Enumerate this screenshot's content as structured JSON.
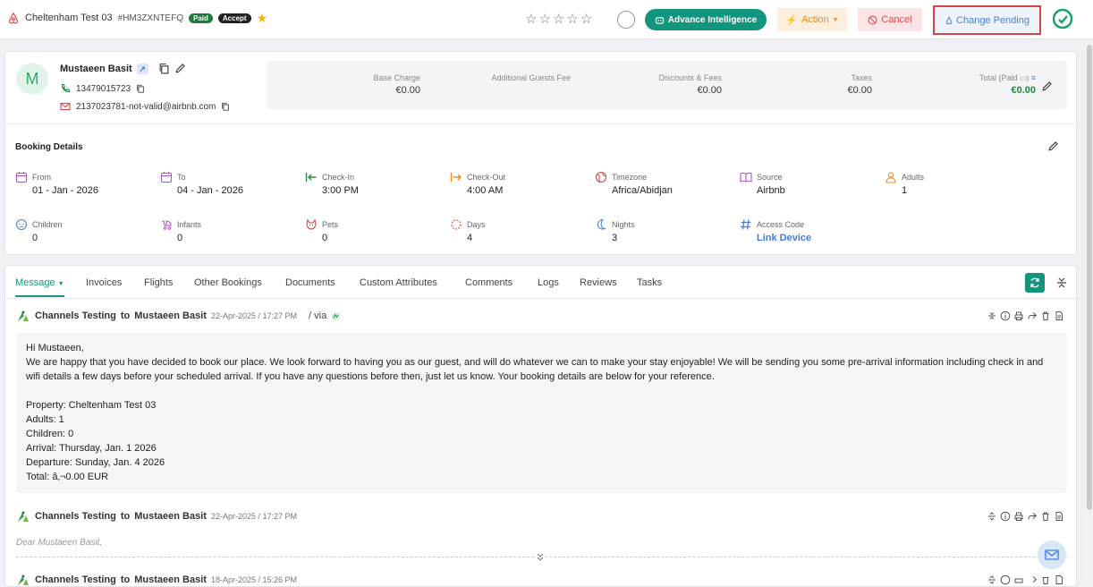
{
  "topbar": {
    "property_title": "Cheltenham Test 03",
    "booking_code": "#HM3ZXNTEFQ",
    "badge_paid": "Paid",
    "badge_accept": "Accept",
    "rating_stars_total": 5,
    "rating_value": 0,
    "ai_button_label": "Advance Intelligence",
    "action_button_label": "Action",
    "cancel_button_label": "Cancel",
    "pending_button_label": "Change Pending",
    "colors": {
      "ai_green": "#11957d",
      "action_orange": "#f08b2a",
      "cancel_red": "#e04b4b",
      "pending_blue": "#4a7fd4",
      "highlight_red": "#d64545"
    }
  },
  "guest": {
    "initial": "M",
    "name": "Mustaeen Basit",
    "phone": "13479015723",
    "email": "2137023781-not-valid@airbnb.com"
  },
  "summary": {
    "base_charge_label": "Base Charge",
    "base_charge_value": "€0.00",
    "guests_fee_label": "Additional Guests Fee",
    "discounts_label": "Discounts & Fees",
    "discounts_value": "€0.00",
    "taxes_label": "Taxes",
    "taxes_value": "€0.00",
    "total_label": "Total (Paid",
    "total_value": "€0.00"
  },
  "booking_details": {
    "title": "Booking Details",
    "from_label": "From",
    "from_value": "01 - Jan - 2026",
    "to_label": "To",
    "to_value": "04 - Jan - 2026",
    "checkin_label": "Check-In",
    "checkin_value": "3:00 PM",
    "checkout_label": "Check-Out",
    "checkout_value": "4:00 AM",
    "timezone_label": "Timezone",
    "timezone_value": "Africa/Abidjan",
    "source_label": "Source",
    "source_value": "Airbnb",
    "adults_label": "Adults",
    "adults_value": "1",
    "children_label": "Children",
    "children_value": "0",
    "infants_label": "Infants",
    "infants_value": "0",
    "pets_label": "Pets",
    "pets_value": "0",
    "days_label": "Days",
    "days_value": "4",
    "nights_label": "Nights",
    "nights_value": "3",
    "access_label": "Access Code",
    "access_value": "Link Device"
  },
  "tabs": [
    "Message",
    "Invoices",
    "Flights",
    "Other Bookings",
    "Documents",
    "Custom Attributes",
    "Comments",
    "Logs",
    "Reviews",
    "Tasks"
  ],
  "messages": [
    {
      "sender": "Channels Testing",
      "to_word": "to",
      "recipient": "Mustaeen Basit",
      "date": "22-Apr-2025 / 17:27 PM",
      "via": "/ via",
      "lines": [
        "Hi Mustaeen,",
        "We are happy that you have decided to book our place. We look forward to having you as our guest, and will do whatever we can to make your stay enjoyable! We will be sending you some pre-arrival information including check in and wifi details a few days before your scheduled arrival. If you have any questions before then, just let us know. Your booking details are below for your reference.",
        "",
        "Property: Cheltenham Test 03",
        "Adults: 1",
        "Children: 0",
        "Arrival: Thursday, Jan. 1 2026",
        "Departure: Sunday, Jan. 4 2026",
        "Total: â‚¬0.00 EUR"
      ]
    },
    {
      "sender": "Channels Testing",
      "to_word": "to",
      "recipient": "Mustaeen Basit",
      "date": "22-Apr-2025 / 17:27 PM",
      "preview": "Dear Mustaeen Basit,"
    },
    {
      "sender": "Channels Testing",
      "to_word": "to",
      "recipient": "Mustaeen Basit",
      "date": "18-Apr-2025 / 15:26 PM"
    }
  ]
}
